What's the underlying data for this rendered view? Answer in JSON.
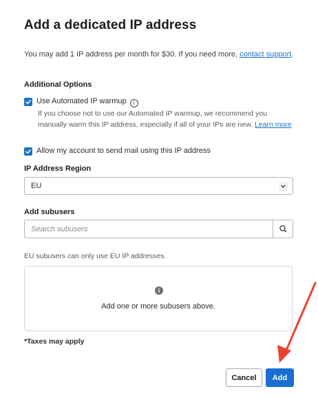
{
  "dialog": {
    "title": "Add a dedicated IP address",
    "intro_text": "You may add 1 IP address per month for $30. If you need more, ",
    "intro_link": "contact support",
    "intro_end": "."
  },
  "additional_options": {
    "heading": "Additional Options",
    "warmup": {
      "label": "Use Automated IP warmup",
      "checked": true,
      "help_text": "If you choose not to use our Automated IP warmup, we recommend you manually warm this IP address, especially if all of your IPs are new. ",
      "help_link": "Learn more"
    },
    "allow_mail": {
      "label": "Allow my account to send mail using this IP address",
      "checked": true
    }
  },
  "region": {
    "label": "IP Address Region",
    "selected": "EU"
  },
  "subusers": {
    "label": "Add subusers",
    "placeholder": "Search subusers",
    "value": "",
    "note": "EU subusers can only use EU IP addresses.",
    "empty_message": "Add one or more subusers above."
  },
  "footer": {
    "tax_note": "*Taxes may apply",
    "cancel_label": "Cancel",
    "add_label": "Add"
  },
  "icons": {
    "checkbox": "check-icon",
    "info": "info-icon",
    "select_caret": "chevron-down-icon",
    "search": "search-icon",
    "annotation": "red-arrow"
  },
  "colors": {
    "accent": "#1a6fd1",
    "link": "#1a73c8",
    "annotation_arrow": "#e8432e"
  }
}
